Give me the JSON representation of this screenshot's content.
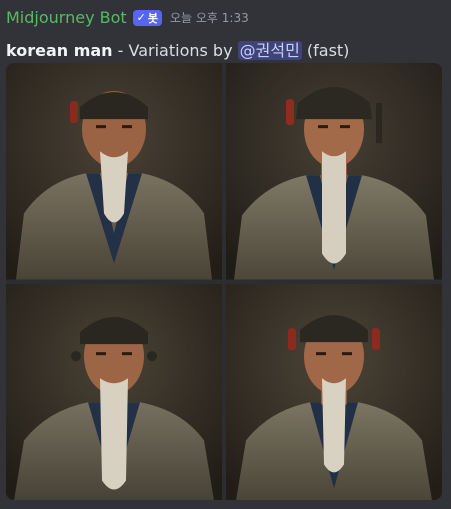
{
  "author": "Midjourney Bot",
  "badge": {
    "check": "✓",
    "label": "봇"
  },
  "timestamp": "오늘 오후 1:33",
  "message": {
    "prompt": "korean man",
    "separator": " - Variations by ",
    "mention": "@권석민",
    "speed": " (fast)"
  },
  "images": [
    {
      "name": "variation-1"
    },
    {
      "name": "variation-2"
    },
    {
      "name": "variation-3"
    },
    {
      "name": "variation-4"
    }
  ],
  "colors": {
    "author": "#57bb63",
    "badge": "#5865f2",
    "background": "#313338",
    "mention_bg": "#5865f2"
  }
}
